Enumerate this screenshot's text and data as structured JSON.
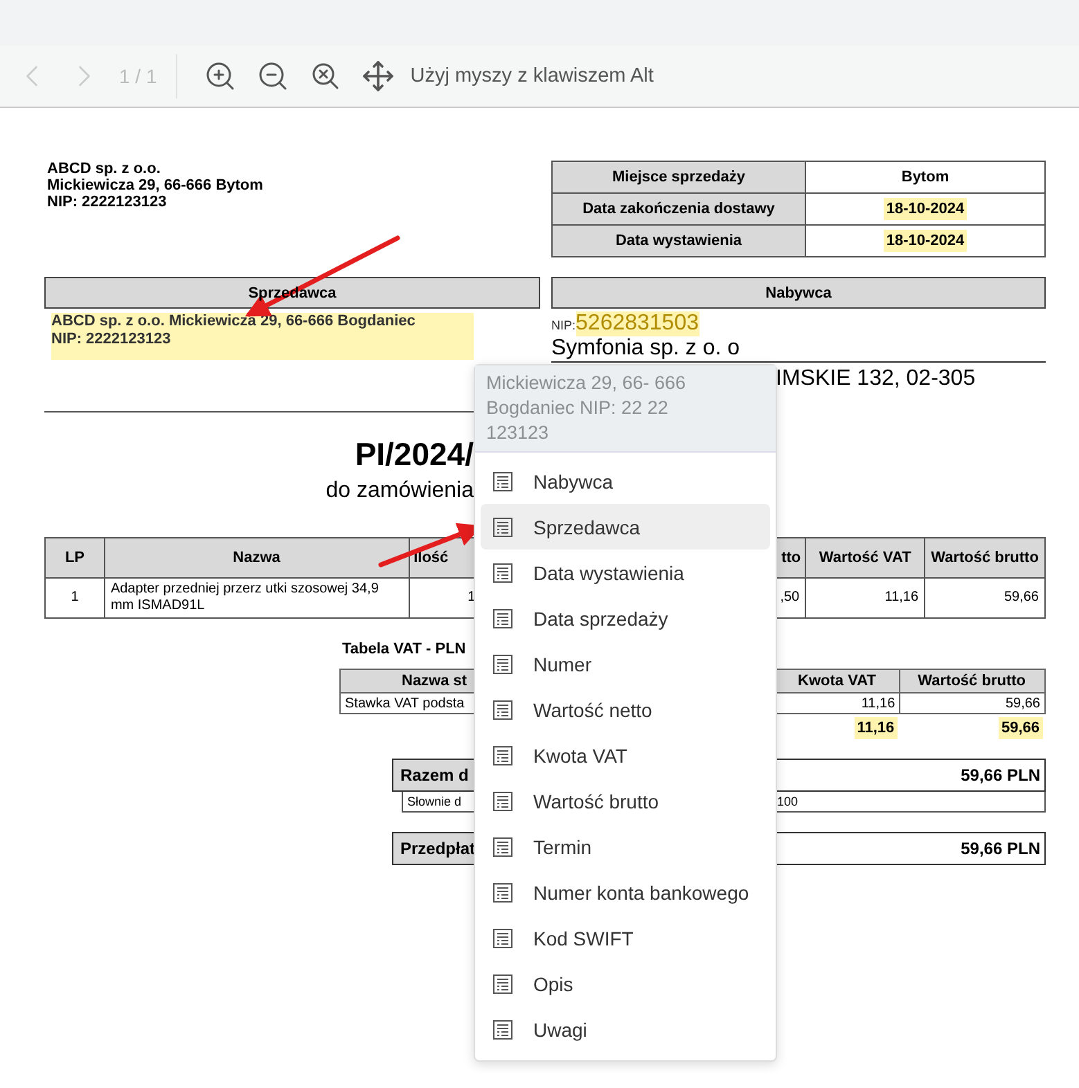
{
  "toolbar": {
    "prev": {
      "disabled": true
    },
    "next": {
      "disabled": true
    },
    "page": "1 / 1",
    "hint": "Użyj myszy z klawiszem Alt"
  },
  "document": {
    "company_lines": [
      "ABCD sp. z o.o.",
      "Mickiewicza 29, 66-666 Bytom",
      "NIP: 2222123123"
    ],
    "info_table": [
      {
        "label": "Miejsce sprzedaży",
        "value": "Bytom",
        "highlighted": false
      },
      {
        "label": "Data zakończenia dostawy",
        "value": "18-10-2024",
        "highlighted": true
      },
      {
        "label": "Data wystawienia",
        "value": "18-10-2024",
        "highlighted": true
      }
    ],
    "seller": {
      "header": "Sprzedawca",
      "lines": [
        "ABCD sp. z o.o. Mickiewicza 29, 66-666 Bogdaniec",
        "NIP: 2222123123"
      ],
      "highlighted": true
    },
    "buyer": {
      "header": "Nabywca",
      "nip_label": "NIP:",
      "nip": "5262831503",
      "name": "Symfonia sp. z o. o",
      "address": "IMSKIE 132, 02-305"
    },
    "title": "PI/2024/",
    "subtitle": "do zamówienia",
    "items_table": {
      "columns": [
        "LP",
        "Nazwa",
        "Ilość",
        "tto",
        "Wartość VAT",
        "Wartość brutto"
      ],
      "rows": [
        [
          "1",
          "Adapter przedniej przerz utki szosowej 34,9 mm ISMAD91L",
          "1",
          ",50",
          "11,16",
          "59,66"
        ]
      ]
    },
    "vat_table": {
      "title": "Tabela VAT - PLN",
      "columns": [
        "Nazwa st",
        "Kwota VAT",
        "Wartość brutto"
      ],
      "rows": [
        [
          "Stawka VAT podsta",
          "11,16",
          "59,66"
        ]
      ],
      "totals": [
        {
          "value": "11,16",
          "highlighted": true
        },
        {
          "value": "59,66",
          "highlighted": true
        }
      ]
    },
    "total": {
      "label": "Razem d",
      "value": "59,66 PLN",
      "words_label": "Słownie d",
      "words_value": "100"
    },
    "prepaid": {
      "label": "Przedpłat",
      "value": "59,66 PLN"
    }
  },
  "context_menu": {
    "header": "Mickiewicza 29, 66- 666 Bogdaniec NIP: 22 22 123123",
    "items": [
      {
        "label": "Nabywca",
        "selected": false
      },
      {
        "label": "Sprzedawca",
        "selected": true
      },
      {
        "label": "Data wystawienia",
        "selected": false
      },
      {
        "label": "Data sprzedaży",
        "selected": false
      },
      {
        "label": "Numer",
        "selected": false
      },
      {
        "label": "Wartość netto",
        "selected": false
      },
      {
        "label": "Kwota VAT",
        "selected": false
      },
      {
        "label": "Wartość brutto",
        "selected": false
      },
      {
        "label": "Termin",
        "selected": false
      },
      {
        "label": "Numer konta bankowego",
        "selected": false
      },
      {
        "label": "Kod SWIFT",
        "selected": false
      },
      {
        "label": "Opis",
        "selected": false
      },
      {
        "label": "Uwagi",
        "selected": false
      }
    ]
  }
}
